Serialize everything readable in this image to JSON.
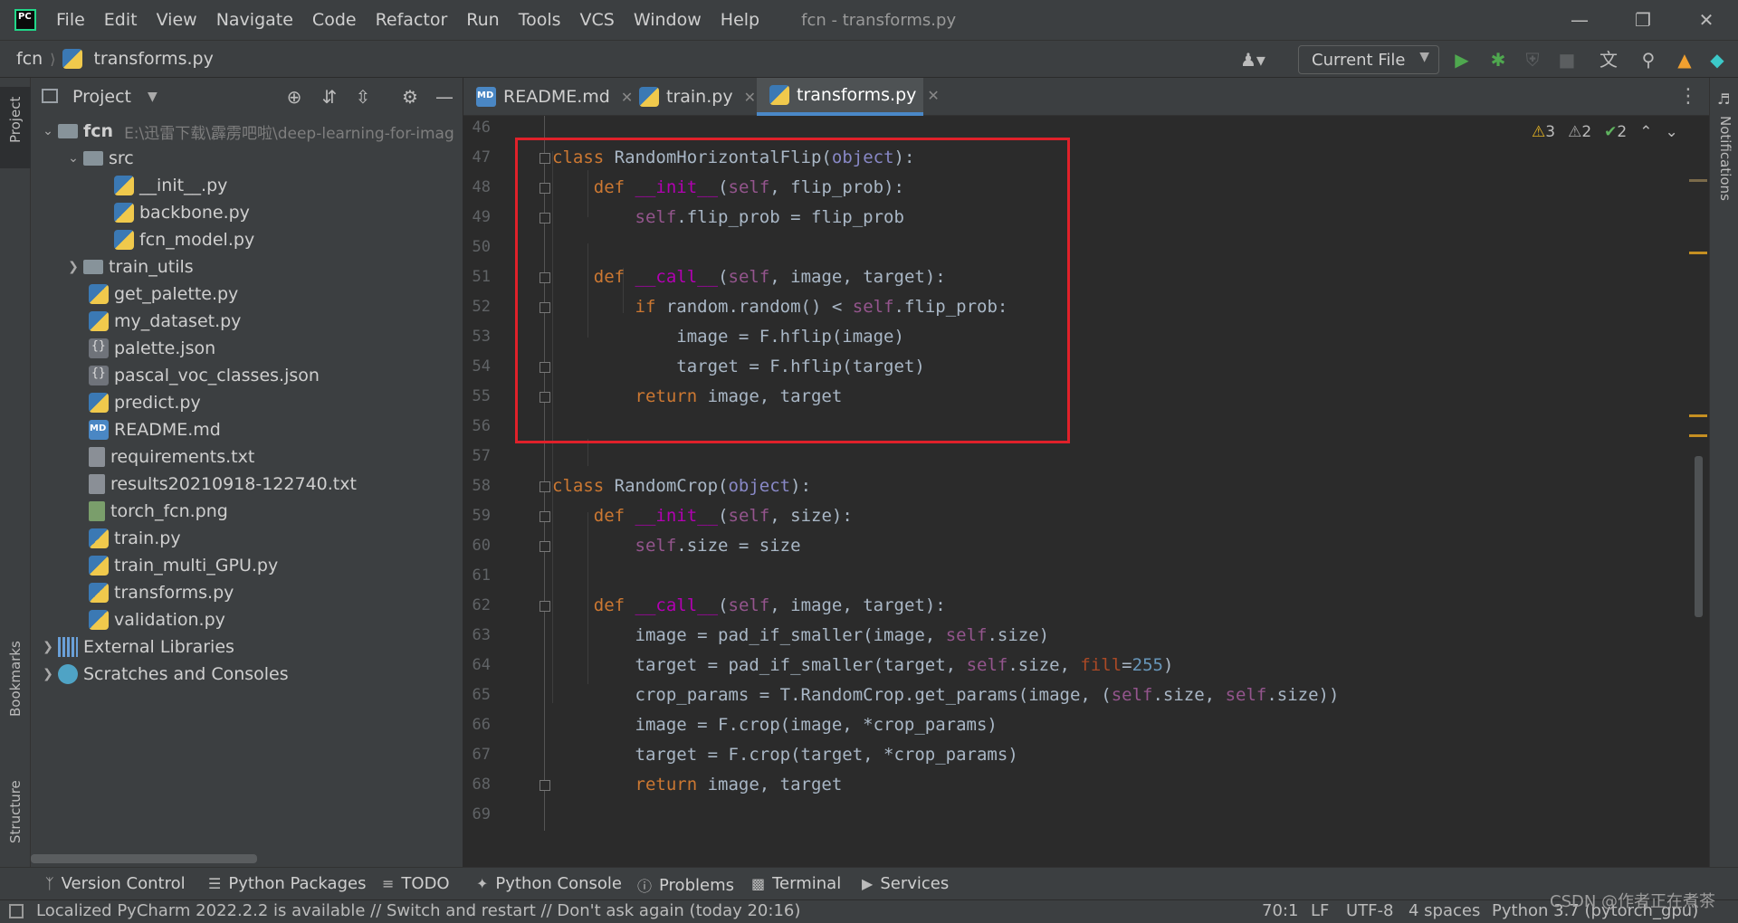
{
  "menubar": {
    "items": [
      "File",
      "Edit",
      "View",
      "Navigate",
      "Code",
      "Refactor",
      "Run",
      "Tools",
      "VCS",
      "Window",
      "Help"
    ],
    "window_title": "fcn - transforms.py"
  },
  "navbar": {
    "project": "fcn",
    "file": "transforms.py",
    "run_config": "Current File"
  },
  "left_strip": {
    "project_tab": "Project",
    "bookmarks_tab": "Bookmarks",
    "structure_tab": "Structure"
  },
  "right_strip": {
    "notifications_tab": "Notifications"
  },
  "project_panel": {
    "title": "Project",
    "root": {
      "name": "fcn",
      "path": "E:\\迅雷下载\\霹雳吧啦\\deep-learning-for-imag"
    },
    "items": [
      {
        "label": "src"
      },
      {
        "label": "__init__.py"
      },
      {
        "label": "backbone.py"
      },
      {
        "label": "fcn_model.py"
      },
      {
        "label": "train_utils"
      },
      {
        "label": "get_palette.py"
      },
      {
        "label": "my_dataset.py"
      },
      {
        "label": "palette.json"
      },
      {
        "label": "pascal_voc_classes.json"
      },
      {
        "label": "predict.py"
      },
      {
        "label": "README.md"
      },
      {
        "label": "requirements.txt"
      },
      {
        "label": "results20210918-122740.txt"
      },
      {
        "label": "torch_fcn.png"
      },
      {
        "label": "train.py"
      },
      {
        "label": "train_multi_GPU.py"
      },
      {
        "label": "transforms.py"
      },
      {
        "label": "validation.py"
      },
      {
        "label": "External Libraries"
      },
      {
        "label": "Scratches and Consoles"
      }
    ]
  },
  "tabs": [
    {
      "label": "README.md"
    },
    {
      "label": "train.py"
    },
    {
      "label": "transforms.py"
    }
  ],
  "inspections": {
    "warnings": "3",
    "weak_warnings": "2",
    "typos": "2"
  },
  "editor": {
    "line_numbers": [
      "46",
      "47",
      "48",
      "49",
      "50",
      "51",
      "52",
      "53",
      "54",
      "55",
      "56",
      "57",
      "58",
      "59",
      "60",
      "61",
      "62",
      "63",
      "64",
      "65",
      "66",
      "67",
      "68",
      "69"
    ]
  },
  "toolwindows": {
    "version_control": "Version Control",
    "python_packages": "Python Packages",
    "todo": "TODO",
    "python_console": "Python Console",
    "problems": "Problems",
    "terminal": "Terminal",
    "services": "Services"
  },
  "statusbar": {
    "message": "Localized PyCharm 2022.2.2 is available // Switch and restart // Don't ask again (today 20:16)",
    "position": "70:1",
    "line_sep": "LF",
    "encoding": "UTF-8",
    "indent": "4 spaces",
    "interpreter": "Python 3.7 (pytorch_gpu)"
  },
  "watermark": "CSDN @作者正在煮茶"
}
